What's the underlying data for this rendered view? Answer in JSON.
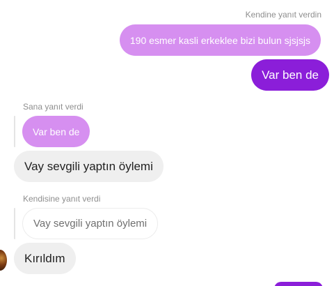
{
  "thread": {
    "messages": [
      {
        "id": "m1",
        "side": "right",
        "reply_context": "Kendine yanıt verdin",
        "quoted_text": "190 esmer kasli erkeklee bizi bulun sjsjsjs",
        "text": "Var ben de"
      },
      {
        "id": "m2",
        "side": "left",
        "reply_context": "Sana yanıt verdi",
        "quoted_text": "Var ben de",
        "text": "Vay sevgili yaptın öylemi"
      },
      {
        "id": "m3",
        "side": "left",
        "reply_context": "Kendisine yanıt verdi",
        "quoted_text": "Vay sevgili yaptın öylemi",
        "text": "Kırıldım"
      }
    ]
  },
  "colors": {
    "sent_bubble": "#8b1ed9",
    "quoted_purple_bubble": "#d68ff0",
    "received_bubble": "#efefef",
    "meta_text": "#8e8e8e"
  },
  "icons": {
    "sender_avatar": "user-avatar-icon"
  }
}
